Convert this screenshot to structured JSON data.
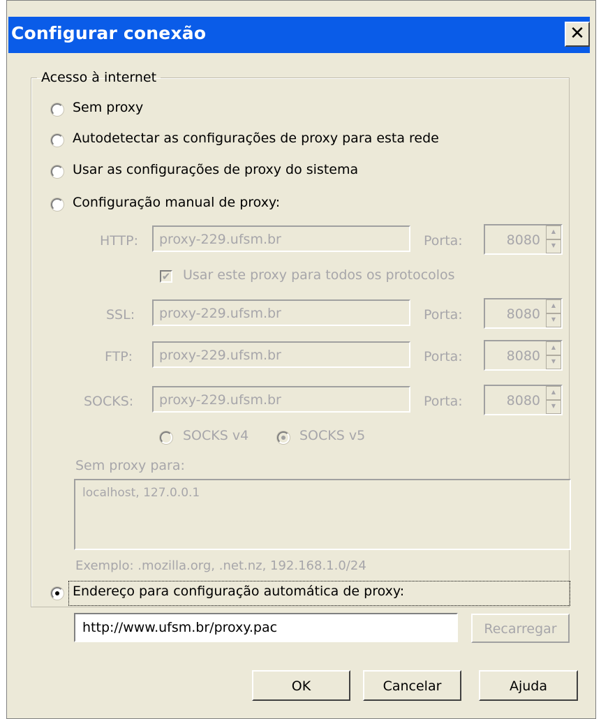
{
  "window": {
    "title": "Configurar conexão"
  },
  "group": {
    "label": "Acesso à internet"
  },
  "options": {
    "no_proxy": {
      "label": "Sem proxy",
      "selected": false
    },
    "auto_detect": {
      "label": "Autodetectar as configurações de proxy para esta rede",
      "selected": false
    },
    "system": {
      "label": "Usar as configurações de proxy do sistema",
      "selected": false
    },
    "manual": {
      "label": "Configuração manual de proxy:",
      "selected": false
    },
    "auto_url": {
      "label": "Endereço para configuração automática de proxy:",
      "selected": true
    }
  },
  "manual": {
    "http": {
      "label": "HTTP:",
      "value": "proxy-229.ufsm.br",
      "port_label": "Porta:",
      "port": "8080"
    },
    "use_for_all": {
      "label": "Usar este proxy para todos os protocolos",
      "checked": true
    },
    "ssl": {
      "label": "SSL:",
      "value": "proxy-229.ufsm.br",
      "port_label": "Porta:",
      "port": "8080"
    },
    "ftp": {
      "label": "FTP:",
      "value": "proxy-229.ufsm.br",
      "port_label": "Porta:",
      "port": "8080"
    },
    "socks": {
      "label": "SOCKS:",
      "value": "proxy-229.ufsm.br",
      "port_label": "Porta:",
      "port": "8080"
    },
    "socks_v4": {
      "label": "SOCKS v4",
      "selected": false
    },
    "socks_v5": {
      "label": "SOCKS v5",
      "selected": true
    },
    "no_proxy_for": {
      "label": "Sem proxy para:",
      "value": "localhost, 127.0.0.1"
    },
    "example": "Exemplo: .mozilla.org, .net.nz, 192.168.1.0/24"
  },
  "auto": {
    "url": "http://www.ufsm.br/proxy.pac",
    "reload_label": "Recarregar"
  },
  "buttons": {
    "ok": "OK",
    "cancel": "Cancelar",
    "help": "Ajuda"
  },
  "icons": {
    "close": "close-icon",
    "spin_up": "spin-up-icon",
    "spin_down": "spin-down-icon",
    "check": "checkmark-icon"
  }
}
